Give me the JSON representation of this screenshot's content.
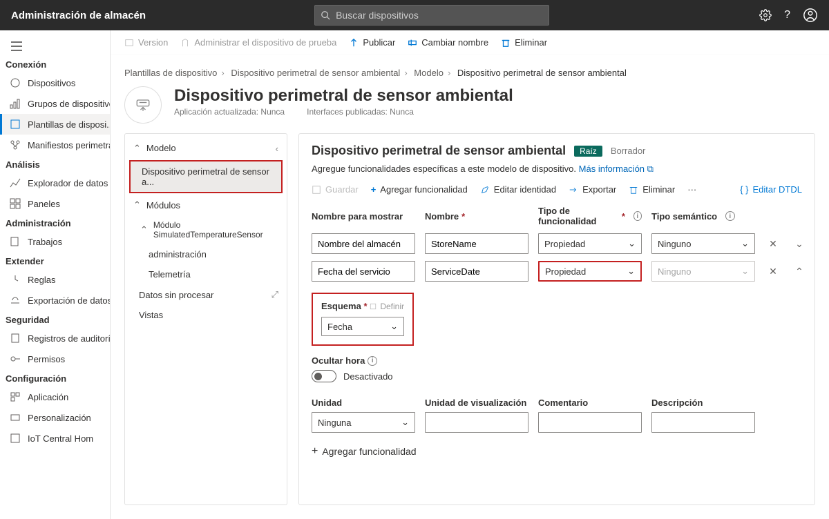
{
  "header": {
    "app_title": "Administración de almacén",
    "search_placeholder": "Buscar dispositivos"
  },
  "sidebar": {
    "sections": {
      "conexion": {
        "label": "Conexión",
        "items": [
          "Dispositivos",
          "Grupos de dispositivos",
          "Plantillas de disposi...",
          "Manifiestos perimetra..."
        ]
      },
      "analisis": {
        "label": "Análisis",
        "items": [
          "Explorador de datos",
          "Paneles"
        ]
      },
      "administracion": {
        "label": "Administración",
        "items": [
          "Trabajos"
        ]
      },
      "extender": {
        "label": "Extender",
        "items": [
          "Reglas",
          "Exportación de datos"
        ]
      },
      "seguridad": {
        "label": "Seguridad",
        "items": [
          "Registros de auditoría",
          "Permisos"
        ]
      },
      "configuracion": {
        "label": "Configuración",
        "items": [
          "Aplicación",
          "Personalización",
          "IoT Central Hom"
        ]
      }
    }
  },
  "top_toolbar": [
    "Version",
    "Administrar el dispositivo de prueba",
    "Publicar",
    "Cambiar nombre",
    "Eliminar"
  ],
  "breadcrumbs": [
    "Plantillas de dispositivo",
    "Dispositivo perimetral de sensor ambiental",
    "Modelo",
    "Dispositivo perimetral de sensor ambiental"
  ],
  "page": {
    "title": "Dispositivo perimetral de sensor ambiental",
    "meta1": "Aplicación actualizada: Nunca",
    "meta2": "Interfaces publicadas: Nunca"
  },
  "tree": {
    "modelo": "Modelo",
    "selected": "Dispositivo perimetral de sensor a...",
    "modulos": "Módulos",
    "module": "Módulo SimulatedTemperatureSensor",
    "admin": "administración",
    "tele": "Telemetría",
    "raw": "Datos sin procesar",
    "vistas": "Vistas"
  },
  "detail": {
    "title": "Dispositivo perimetral de sensor ambiental",
    "badge": "Raíz",
    "draft": "Borrador",
    "desc": "Agregue funcionalidades específicas a este modelo de dispositivo.",
    "more": "Más información",
    "toolbar": {
      "guardar": "Guardar",
      "agregar": "Agregar funcionalidad",
      "editar": "Editar identidad",
      "exportar": "Exportar",
      "eliminar": "Eliminar",
      "dtdl": "Editar DTDL"
    },
    "labels": {
      "display": "Nombre para mostrar",
      "name": "Nombre",
      "captype": "Tipo de funcionalidad",
      "semtype": "Tipo semántico"
    },
    "rows": [
      {
        "display": "Nombre del almacén",
        "name": "StoreName",
        "captype": "Propiedad",
        "semtype": "Ninguno"
      },
      {
        "display": "Fecha del servicio",
        "name": "ServiceDate",
        "captype": "Propiedad",
        "semtype": "Ninguno"
      }
    ],
    "schema": {
      "label": "Esquema",
      "define": "Definir",
      "value": "Fecha"
    },
    "hide_time": {
      "label": "Ocultar hora",
      "state": "Desactivado"
    },
    "extra": {
      "unidad": "Unidad",
      "unidadvis": "Unidad de visualización",
      "comentario": "Comentario",
      "descripcion": "Descripción",
      "unidad_val": "Ninguna"
    },
    "addcap": "Agregar funcionalidad"
  }
}
